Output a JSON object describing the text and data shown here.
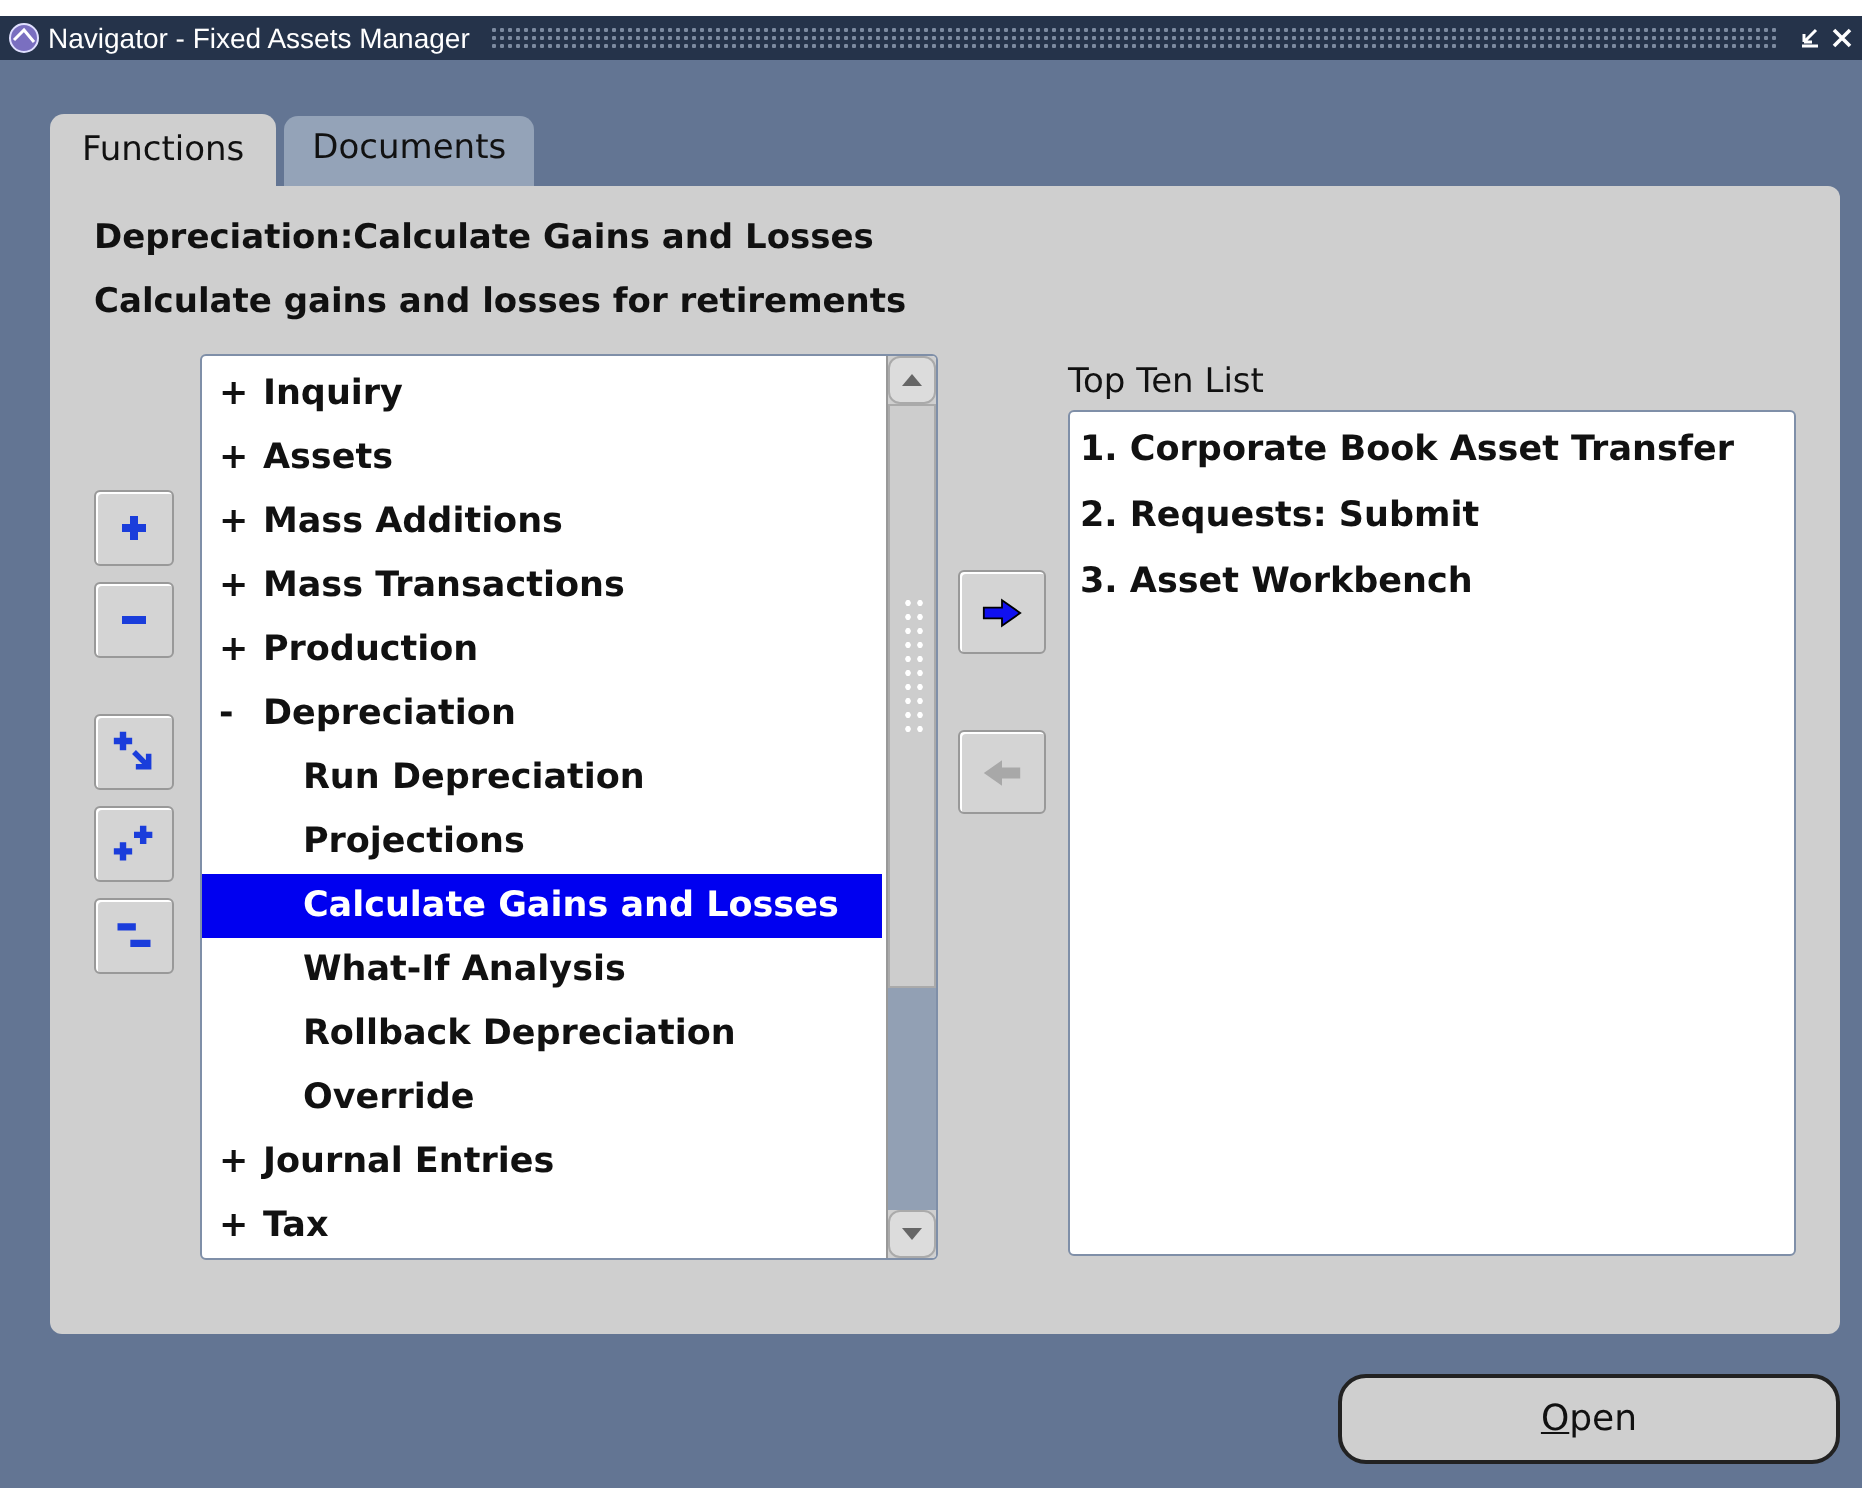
{
  "window": {
    "title": "Navigator - Fixed Assets Manager"
  },
  "tabs": [
    {
      "label": "Functions",
      "selected": true
    },
    {
      "label": "Documents",
      "selected": false
    }
  ],
  "heading": "Depreciation:Calculate Gains and Losses",
  "description": "Calculate gains and losses for retirements",
  "tree": {
    "items": [
      {
        "marker": "+",
        "label": "Inquiry",
        "selected": false
      },
      {
        "marker": "+",
        "label": "Assets",
        "selected": false
      },
      {
        "marker": "+",
        "label": "Mass Additions",
        "selected": false
      },
      {
        "marker": "+",
        "label": "Mass Transactions",
        "selected": false
      },
      {
        "marker": "+",
        "label": "Production",
        "selected": false
      },
      {
        "marker": "-",
        "label": "Depreciation",
        "selected": false,
        "children": [
          {
            "label": "Run Depreciation",
            "selected": false
          },
          {
            "label": "Projections",
            "selected": false
          },
          {
            "label": "Calculate Gains and Losses",
            "selected": true
          },
          {
            "label": "What-If Analysis",
            "selected": false
          },
          {
            "label": "Rollback Depreciation",
            "selected": false
          },
          {
            "label": "Override",
            "selected": false
          }
        ]
      },
      {
        "marker": "+",
        "label": "Journal Entries",
        "selected": false
      },
      {
        "marker": "+",
        "label": "Tax",
        "selected": false
      }
    ]
  },
  "transfer_buttons": [
    {
      "kind": "add",
      "disabled": false
    },
    {
      "kind": "remove",
      "disabled": true
    }
  ],
  "top_ten": {
    "label": "Top Ten List",
    "items": [
      "1. Corporate Book Asset Transfer",
      "2. Requests: Submit",
      "3. Asset Workbench"
    ]
  },
  "open_button": {
    "label": "Open"
  }
}
